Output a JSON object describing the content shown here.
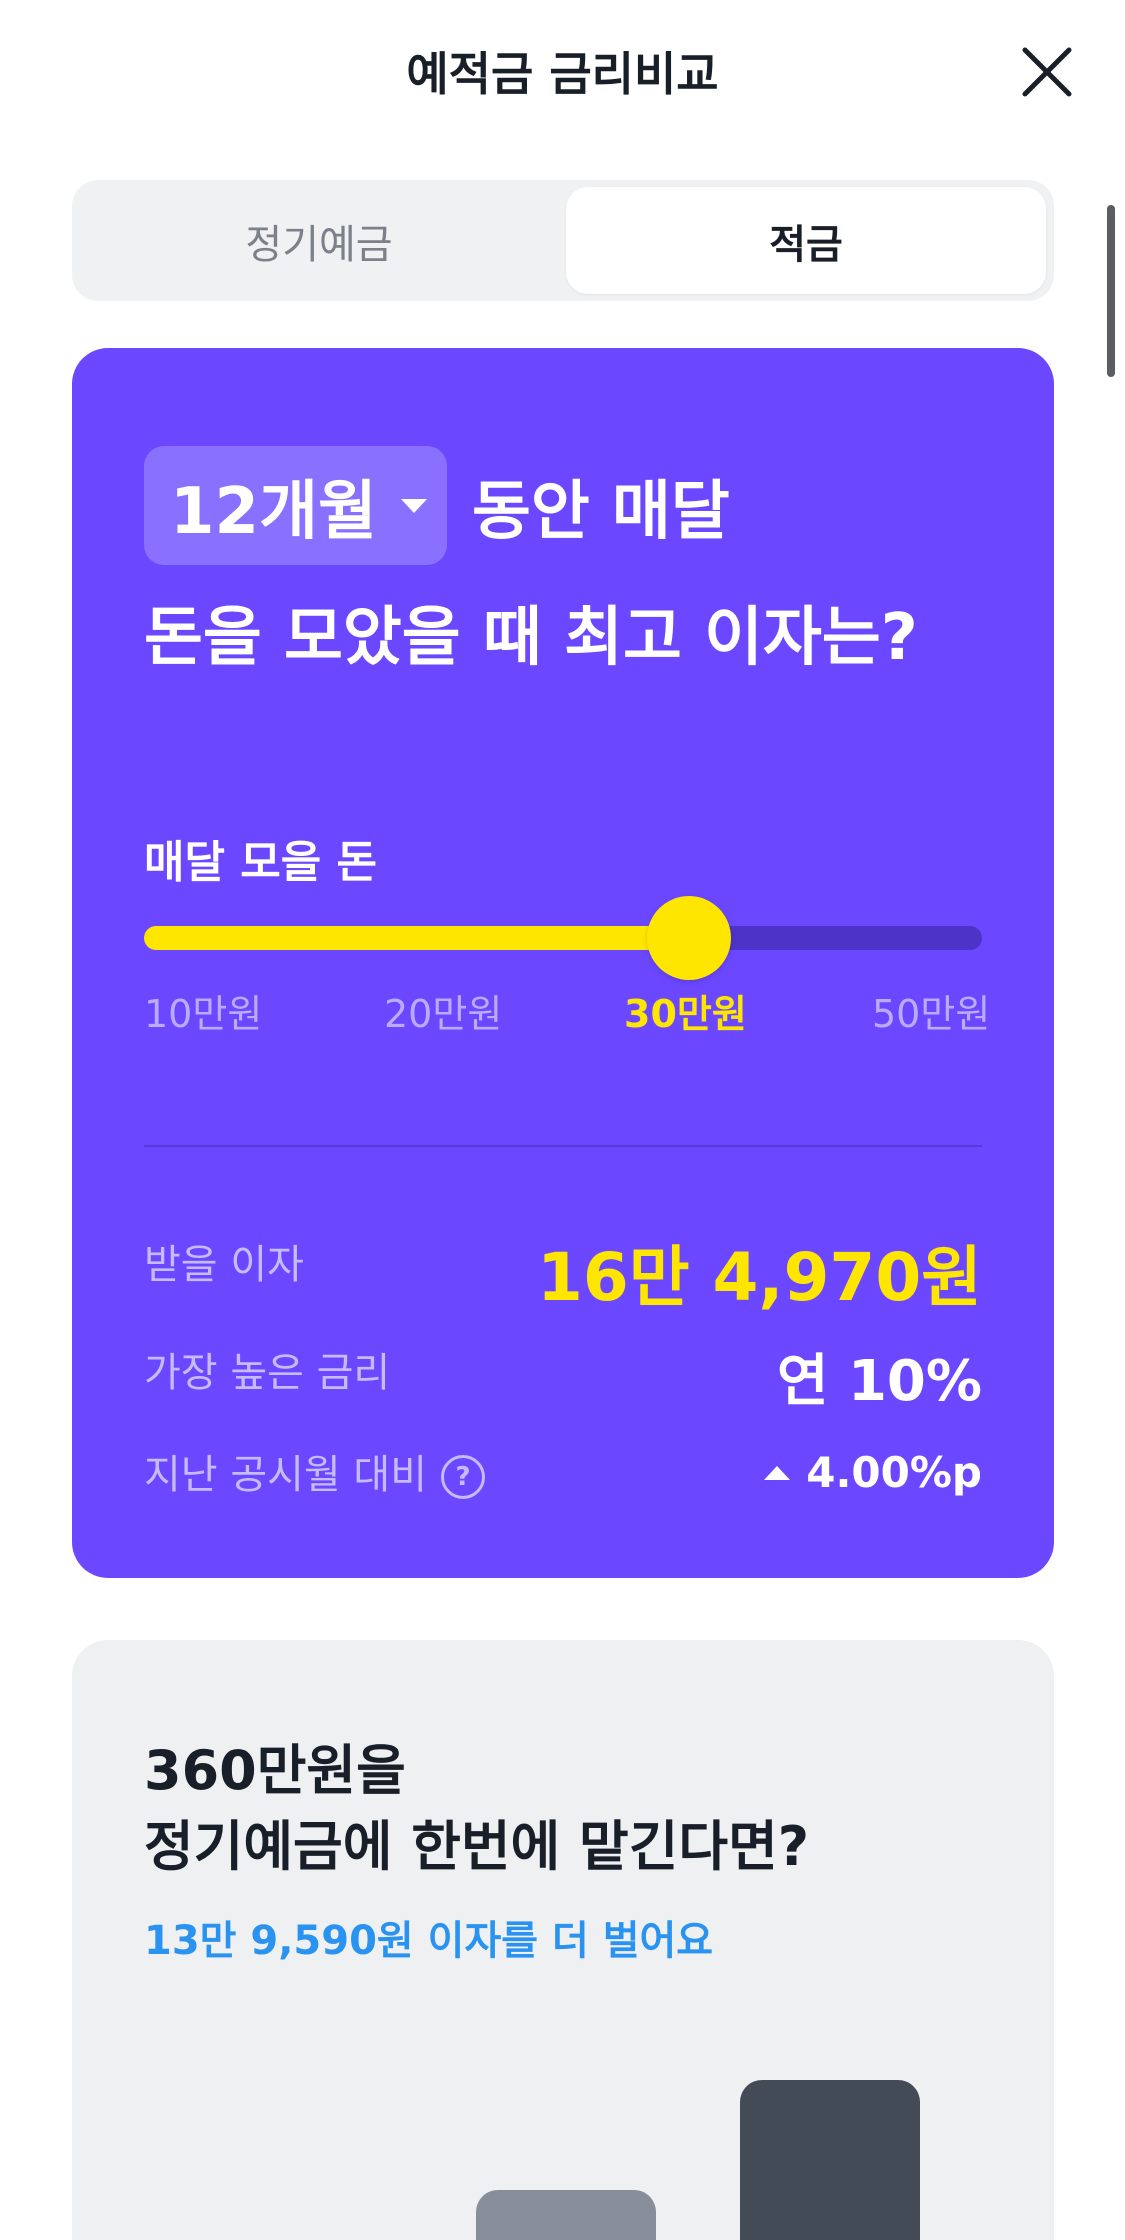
{
  "header": {
    "title": "예적금 금리비교"
  },
  "tabs": [
    {
      "label": "정기예금",
      "active": false
    },
    {
      "label": "적금",
      "active": true
    }
  ],
  "savings_card": {
    "period_label": "12개월",
    "headline_line1": "동안 매달",
    "headline_line2": "돈을 모았을 때 최고 이자는?",
    "slider": {
      "label": "매달 모을 돈",
      "ticks": [
        "10만원",
        "20만원",
        "30만원",
        "50만원"
      ],
      "selected": "30만원",
      "selected_fraction": 0.65
    },
    "rows": [
      {
        "label": "받을 이자",
        "value": "16만 4,970원"
      },
      {
        "label": "가장 높은 금리",
        "value": "연 10%"
      },
      {
        "label": "지난 공시월 대비",
        "value": "4.00%p"
      }
    ]
  },
  "compare_card": {
    "title_line1": "360만원을",
    "title_line2": "정기예금에 한번에 맡긴다면?",
    "subtitle": "13만 9,590원 이자를 더 벌어요"
  },
  "colors": {
    "accent": "#6b48ff",
    "highlight": "#ffe600",
    "link_blue": "#2a93f0"
  }
}
